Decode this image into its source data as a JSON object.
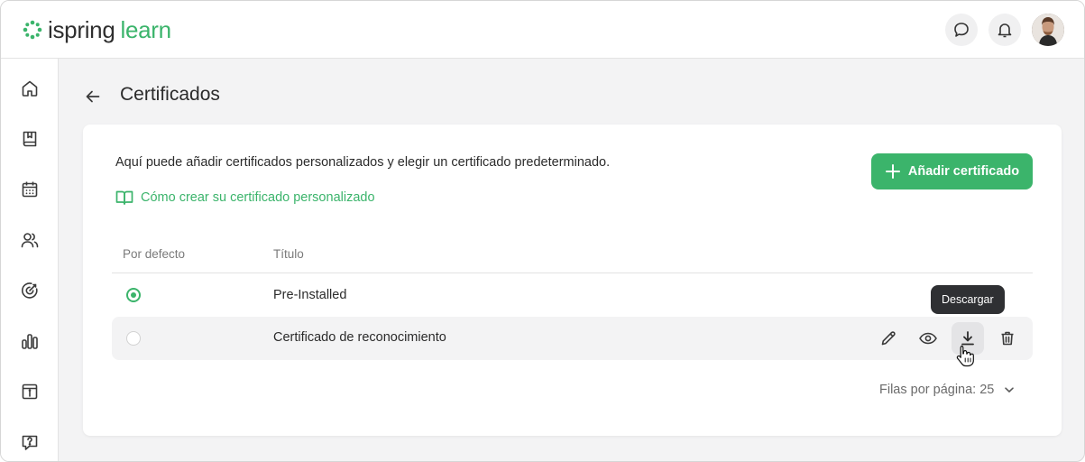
{
  "app": {
    "logo_main": "ispring",
    "logo_sub": "learn",
    "brand_color": "#3bb46b"
  },
  "header": {
    "icons": [
      "chat-icon",
      "bell-icon",
      "avatar"
    ]
  },
  "sidebar": {
    "items": [
      {
        "icon": "home-icon"
      },
      {
        "icon": "book-icon"
      },
      {
        "icon": "calendar-icon"
      },
      {
        "icon": "users-icon"
      },
      {
        "icon": "target-icon"
      },
      {
        "icon": "bar-chart-icon"
      },
      {
        "icon": "info-box-icon"
      },
      {
        "icon": "help-chat-icon"
      }
    ]
  },
  "page": {
    "title": "Certificados"
  },
  "card": {
    "intro": "Aquí puede añadir certificados personalizados y elegir un certificado predeterminado.",
    "howto_link": "Cómo crear su certificado personalizado",
    "add_button": "Añadir certificado"
  },
  "table": {
    "columns": [
      "Por defecto",
      "Título"
    ],
    "rows": [
      {
        "default": true,
        "title": "Pre-Installed"
      },
      {
        "default": false,
        "title": "Certificado de reconocimiento"
      }
    ],
    "row_actions": [
      "pencil-icon",
      "eye-icon",
      "download-icon",
      "trash-icon"
    ]
  },
  "tooltip": {
    "text": "Descargar"
  },
  "pagination": {
    "label": "Filas por página:",
    "value": "25"
  }
}
